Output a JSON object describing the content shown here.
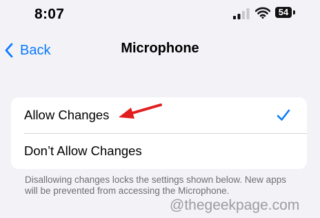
{
  "status_bar": {
    "time": "8:07",
    "battery": "54",
    "icons": [
      "signal-icon",
      "wifi-icon",
      "battery-icon"
    ]
  },
  "nav": {
    "back_label": "Back",
    "back_icon": "chevron-left-icon",
    "title": "Microphone"
  },
  "options": [
    {
      "label": "Allow Changes",
      "selected": true
    },
    {
      "label": "Don’t Allow Changes",
      "selected": false
    }
  ],
  "footer": {
    "note": "Disallowing changes locks the settings shown below. New apps will be prevented from accessing the Microphone."
  },
  "watermark": "@thegeekpage.com",
  "colors": {
    "background": "#f2f2f7",
    "accent": "#0a7aff",
    "annotation": "#e11d1d",
    "secondary_text": "#6e6e73"
  }
}
